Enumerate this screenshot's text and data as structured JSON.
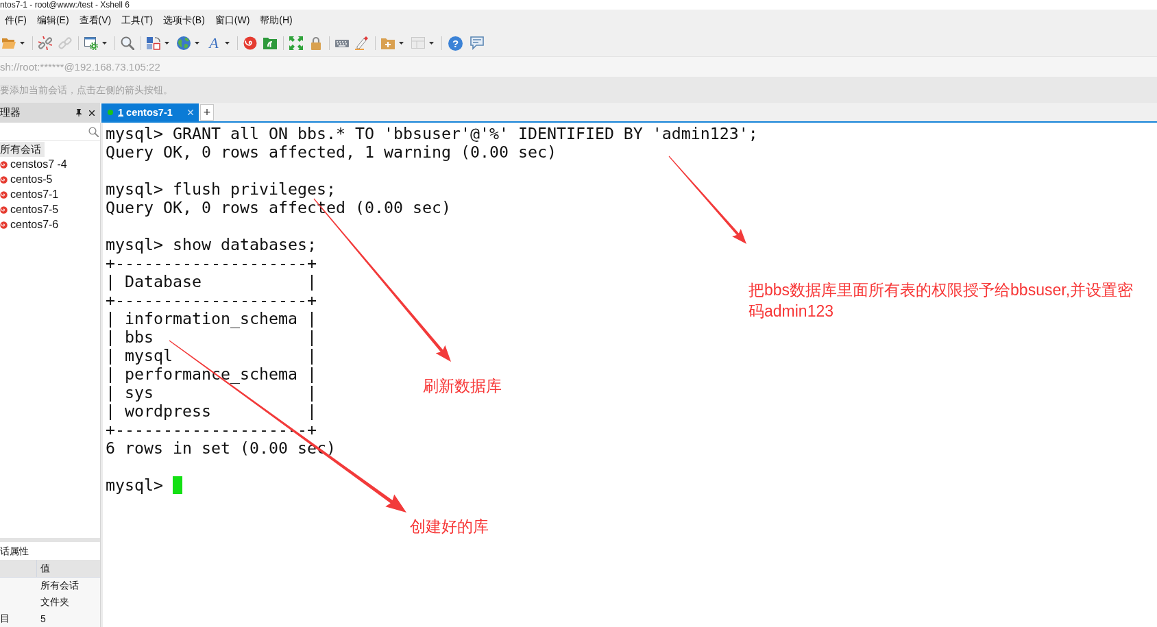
{
  "window": {
    "title": "ntos7-1 - root@www:/test - Xshell 6"
  },
  "menu": [
    "件(F)",
    "编辑(E)",
    "查看(V)",
    "工具(T)",
    "选项卡(B)",
    "窗口(W)",
    "帮助(H)"
  ],
  "toolbar": [
    {
      "disabled": false
    },
    {
      "disabled": false
    },
    {
      "disabled": true
    },
    {
      "disabled": false
    },
    {
      "disabled": false
    },
    {
      "disabled": false
    },
    {
      "disabled": false
    },
    {
      "glyph": "A",
      "disabled": false
    },
    {
      "disabled": false
    },
    {
      "disabled": false
    },
    {
      "disabled": false
    },
    {
      "disabled": false
    },
    {
      "disabled": false
    },
    {
      "disabled": false
    },
    {
      "disabled": false
    },
    {
      "disabled": true
    },
    {
      "glyph": "?",
      "disabled": false
    },
    {
      "disabled": false
    }
  ],
  "address_bar": {
    "value": "sh://root:******@192.168.73.105:22"
  },
  "hint": "要添加当前会话，点击左侧的箭头按钮。",
  "session_manager": {
    "title": "理器",
    "tree": {
      "label": "所有会话",
      "selected": true,
      "children": [
        {
          "label": "censtos7 -4",
          "selected": false
        },
        {
          "label": "centos-5",
          "selected": false
        },
        {
          "label": "centos7-1",
          "selected": false
        },
        {
          "label": "centos7-5",
          "selected": false
        },
        {
          "label": "centos7-6",
          "selected": false
        }
      ]
    }
  },
  "properties": {
    "title": "话属性",
    "value_heading": "值",
    "rows": [
      {
        "value": "所有会话"
      },
      {
        "value": "文件夹"
      },
      {
        "name": "目",
        "value": "5"
      }
    ]
  },
  "tabs": [
    {
      "number": "1",
      "label": "centos7-1",
      "selected": true,
      "connected": true
    }
  ],
  "new_tab": "+",
  "terminal": {
    "blocks": [
      [
        "mysql> GRANT all ON bbs.* TO 'bbsuser'@'%' IDENTIFIED BY 'admin123';",
        "Query OK, 0 rows affected, 1 warning (0.00 sec)"
      ],
      [
        "mysql> flush privileges;",
        "Query OK, 0 rows affected (0.00 sec)"
      ],
      [
        "mysql> show databases;",
        "+--------------------+",
        "| Database           |",
        "+--------------------+",
        "| information_schema |",
        "| bbs                |",
        "| mysql              |",
        "| performance_schema |",
        "| sys                |",
        "| wordpress          |",
        "+--------------------+",
        "6 rows in set (0.00 sec)"
      ]
    ],
    "prompt": "mysql>"
  },
  "annotations": [
    {
      "text": "把bbs数据库里面所有表的权限授予给bbsuser,并设置密码admin123"
    },
    {
      "text": "刷新数据库"
    },
    {
      "text": "创建好的库"
    }
  ]
}
